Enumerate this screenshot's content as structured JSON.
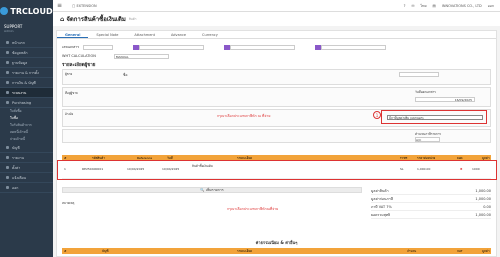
{
  "app": {
    "brand": "TRCLOUD",
    "profile": {
      "title": "SUPPORT",
      "role": "Admin",
      "company": "BOOTSTRAP"
    },
    "topbar": {
      "extension": "EXTENSION",
      "lang": "ไทย",
      "company_name": "INNOVATIONS CO., LTD",
      "exit_label": "ออก"
    }
  },
  "page": {
    "title": "จัดการสินค้าซื้อเงินเดิม",
    "subtitle": "สินค้า"
  },
  "sidebar": {
    "items": [
      {
        "label": "หน้าแรก",
        "active": false
      },
      {
        "label": "ข้อมูลหลัก",
        "active": false
      },
      {
        "label": "ฐานข้อมูล",
        "active": false
      },
      {
        "label": "รายงาน & การตั้ง",
        "active": false
      },
      {
        "label": "การเงิน & บัญชี",
        "active": false
      },
      {
        "label": "ระบบงาน",
        "active": true
      },
      {
        "label": "Purchasing",
        "active": false
      }
    ],
    "sub": [
      {
        "label": "ใบสั่งซื้อ",
        "hl": false
      },
      {
        "label": "ใบซื้อ",
        "hl": true
      },
      {
        "label": "ใบรับสินค้าจาก",
        "hl": false
      },
      {
        "label": "ลดหนี้เจ้าหนี้",
        "hl": false
      },
      {
        "label": "จ่ายเจ้าหนี้",
        "hl": false
      }
    ],
    "more": [
      "บัญชี",
      "รายงาน",
      "ตั้งค่า",
      "แจ้งเตือน",
      "ออก",
      "อื่นๆ",
      "Plugins"
    ]
  },
  "tabs": [
    "General",
    "Special Note",
    "Attachment",
    "Advance",
    "Currency"
  ],
  "form": {
    "doc_label": "เลขเอกสาร",
    "wht_label": "WHT CALCULATION",
    "wht_value": "MANUAL",
    "section_title": "รายละเอียดผู้ขาย",
    "vendor_label": "ผู้ขาย",
    "vendor_name": "ชื่อ",
    "address": "ที่อยู่ผู้ขาย",
    "ref_label": "อ้างอิง",
    "date_label": "วันที่ออกเอกสาร",
    "date_value": "16/09/2025",
    "notice_text": "กรุณาเลือกประเภทภาษีหัก ณ ที่จ่าย",
    "vat_select": "มีภาษีมูลค่าเพิ่ม (แยกนอก)",
    "tax_label": "คำนวณภาษีรายการ",
    "ref_code": "A/C"
  },
  "table": {
    "headers": [
      "#",
      "รหัสสินค้า",
      "Reference",
      "วันที่",
      "รายละเอียด",
      "TYPE",
      "ราคาต่อหน่วย",
      "ยอด",
      "มูลค่า"
    ],
    "rows": [
      {
        "idx": "1",
        "code": "RE250400001",
        "ref": "10/04/2025",
        "date": "10/04/2025",
        "desc": "สินค้าซื้อเงินเดิม",
        "type": "SL",
        "unit_price": "1,000.00",
        "amount": "1000",
        "total": "1,000.00"
      }
    ],
    "add_label": "เพิ่มรายการ",
    "note": "หมายเหตุ",
    "red_note": "กรุณาเลือกประเภทภาษีหักณที่จ่าย"
  },
  "totals": {
    "items": [
      {
        "label": "มูลค่าสินค้า",
        "value": "1,000.00"
      },
      {
        "label": "มูลค่าก่อนภาษี",
        "value": "1,000.00"
      },
      {
        "label": "ภาษี VAT 7%",
        "value": "0.00"
      },
      {
        "label": "ยอดรวมสุทธิ",
        "value": "1,000.00"
      }
    ]
  },
  "section2": {
    "title": "ค่าธรรมเนียม & ค่าอื่นๆ",
    "headers": [
      "#",
      "บัญชี",
      "รายละเอียด",
      "จำนวน",
      "VAT",
      "มูลค่า"
    ]
  }
}
